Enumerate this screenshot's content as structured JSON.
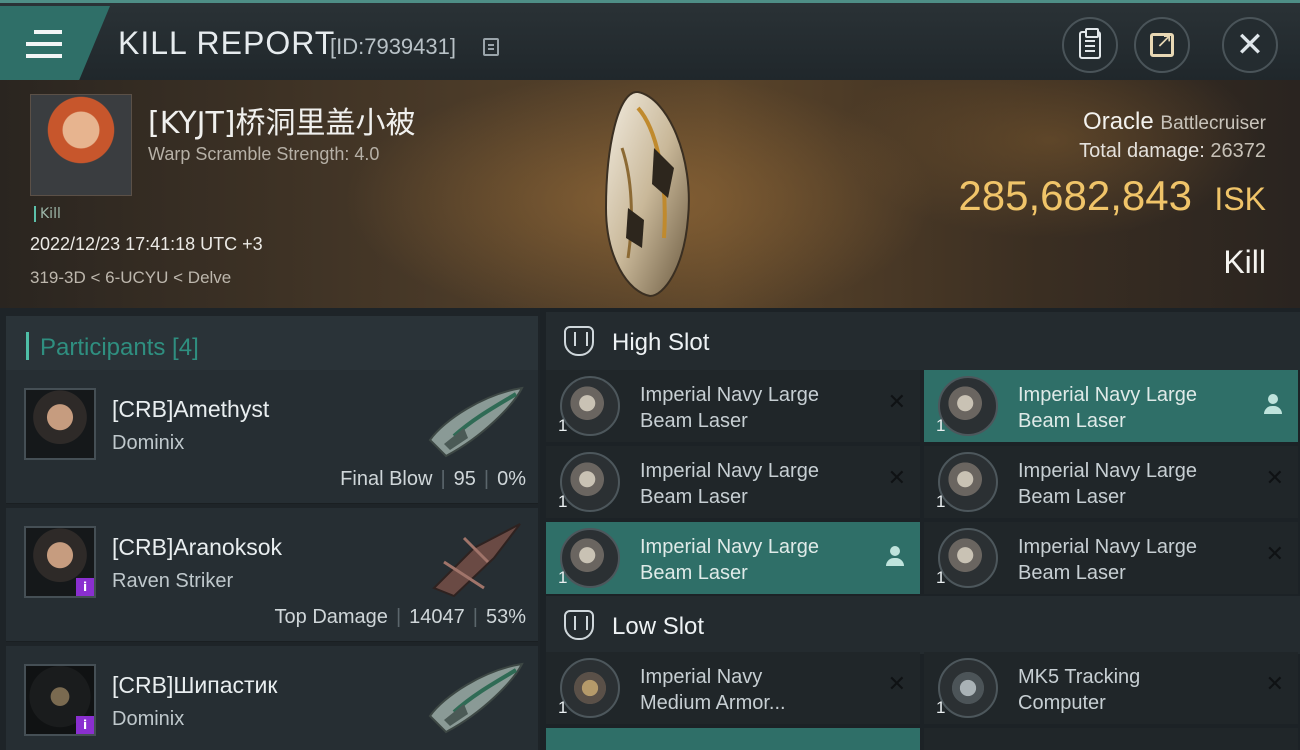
{
  "header": {
    "title": "KILL REPORT",
    "report_id": "[ID:7939431]",
    "menu_icon": "hamburger-icon",
    "buttons": [
      "clipboard-icon",
      "share-icon",
      "close-icon"
    ]
  },
  "victim": {
    "pilot_name": "[KYJT]桥洞里盖小被",
    "warp_scramble": "Warp Scramble Strength: 4.0",
    "tag": "Kill",
    "datetime": "2022/12/23 17:41:18 UTC +3",
    "location": "319-3D < 6-UCYU < Delve",
    "ship_name": "Oracle",
    "ship_class": "Battlecruiser",
    "total_damage_label": "Total damage:",
    "total_damage": "26372",
    "isk_value": "285,682,843",
    "isk_unit": "ISK",
    "result": "Kill"
  },
  "participants": {
    "title": "Participants [4]",
    "list": [
      {
        "name": "[CRB]Amethyst",
        "ship": "Dominix",
        "role": "Final Blow",
        "damage": "95",
        "percent": "0%",
        "badge": ""
      },
      {
        "name": "[CRB]Aranoksok",
        "ship": "Raven Striker",
        "role": "Top Damage",
        "damage": "14047",
        "percent": "53%",
        "badge": "i"
      },
      {
        "name": "[CRB]Шипастик",
        "ship": "Dominix",
        "role": "",
        "damage": "",
        "percent": "",
        "badge": "i"
      }
    ]
  },
  "fitting": {
    "high_slot_label": "High Slot",
    "low_slot_label": "Low Slot",
    "high_slot": [
      {
        "name_line1": "Imperial Navy Large",
        "name_line2": "Beam Laser",
        "qty": "1",
        "highlight": false,
        "marker": "x"
      },
      {
        "name_line1": "Imperial Navy Large",
        "name_line2": "Beam Laser",
        "qty": "1",
        "highlight": true,
        "marker": "person"
      },
      {
        "name_line1": "Imperial Navy Large",
        "name_line2": "Beam Laser",
        "qty": "1",
        "highlight": false,
        "marker": "x"
      },
      {
        "name_line1": "Imperial Navy Large",
        "name_line2": "Beam Laser",
        "qty": "1",
        "highlight": false,
        "marker": "x"
      },
      {
        "name_line1": "Imperial Navy Large",
        "name_line2": "Beam Laser",
        "qty": "1",
        "highlight": true,
        "marker": "person"
      },
      {
        "name_line1": "Imperial Navy Large",
        "name_line2": "Beam Laser",
        "qty": "1",
        "highlight": false,
        "marker": "x"
      }
    ],
    "low_slot": [
      {
        "name_line1": "Imperial Navy",
        "name_line2": "Medium Armor...",
        "qty": "1",
        "highlight": false,
        "marker": "x"
      },
      {
        "name_line1": "MK5 Tracking",
        "name_line2": "Computer",
        "qty": "1",
        "highlight": false,
        "marker": "x"
      }
    ]
  },
  "colors": {
    "accent": "#2f6f68",
    "isk_gold": "#f0c469",
    "purple_badge": "#8a2fd0"
  }
}
